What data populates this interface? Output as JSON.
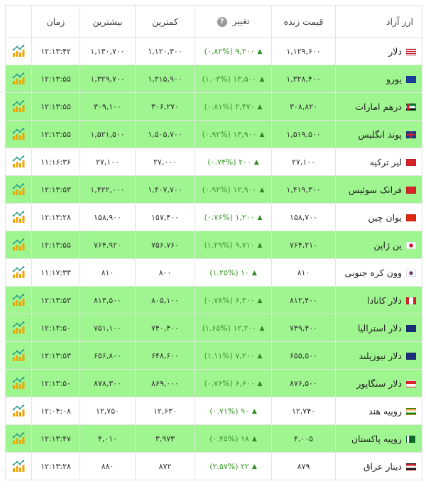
{
  "headers": {
    "name": "ارز آزاد",
    "live": "قیمت زنده",
    "change": "تغییر",
    "change_help": "?",
    "low": "کمترین",
    "high": "بیشترین",
    "time": "زمان"
  },
  "rows": [
    {
      "name": "دلار",
      "flag": "us-flag-icon",
      "live": "۱,۱۲۹,۶۰۰",
      "change": "۹,۲۰۰ (۰.۸۲%)",
      "low": "۱,۱۲۰,۳۰۰",
      "high": "۱,۱۳۰,۷۰۰",
      "time": "۱۲:۱۳:۴۲",
      "bg": "white"
    },
    {
      "name": "یورو",
      "flag": "eu-flag-icon",
      "live": "۱,۳۲۸,۴۰۰",
      "change": "۱۳,۵۰۰ (۱.۰۳%)",
      "low": "۱,۳۱۵,۹۰۰",
      "high": "۱,۳۲۹,۷۰۰",
      "time": "۱۲:۱۳:۵۵",
      "bg": "green"
    },
    {
      "name": "درهم امارات",
      "flag": "ae-flag-icon",
      "live": "۳۰۸,۸۲۰",
      "change": "۲,۴۷۰ (۰.۸۱%)",
      "low": "۳۰۶,۲۷۰",
      "high": "۳۰۹,۱۰۰",
      "time": "۱۲:۱۳:۵۵",
      "bg": "green"
    },
    {
      "name": "پوند انگلیس",
      "flag": "gb-flag-icon",
      "live": "۱,۵۱۹,۵۰۰",
      "change": "۱۳,۹۰۰ (۰.۹۲%)",
      "low": "۱,۵۰۵,۷۰۰",
      "high": "۱,۵۲۱,۵۰۰",
      "time": "۱۲:۱۳:۵۵",
      "bg": "green"
    },
    {
      "name": "لیر ترکیه",
      "flag": "tr-flag-icon",
      "live": "۲۷,۱۰۰",
      "change": "۲۰۰ (۰.۷۴%)",
      "low": "۲۷,۰۰۰",
      "high": "۲۷,۱۰۰",
      "time": "۱۱:۱۶:۳۶",
      "bg": "white"
    },
    {
      "name": "فرانک سوئیس",
      "flag": "ch-flag-icon",
      "live": "۱,۴۱۹,۳۰۰",
      "change": "۱۲,۹۰۰ (۰.۹۲%)",
      "low": "۱,۴۰۷,۷۰۰",
      "high": "۱,۴۲۲,۰۰۰",
      "time": "۱۲:۱۳:۵۳",
      "bg": "green"
    },
    {
      "name": "یوان چین",
      "flag": "cn-flag-icon",
      "live": "۱۵۸,۷۰۰",
      "change": "۱,۲۰۰ (۰.۷۶%)",
      "low": "۱۵۷,۴۰۰",
      "high": "۱۵۸,۹۰۰",
      "time": "۱۲:۱۳:۲۸",
      "bg": "white"
    },
    {
      "name": "ین ژاپن",
      "flag": "jp-flag-icon",
      "live": "۷۶۴,۲۱۰",
      "change": "۹,۷۱۰ (۱.۲۹%)",
      "low": "۷۵۶,۷۶۰",
      "high": "۷۶۴,۹۲۰",
      "time": "۱۲:۱۳:۵۵",
      "bg": "green"
    },
    {
      "name": "وون کره جنوبی",
      "flag": "kr-flag-icon",
      "live": "۸۱۰",
      "change": "۱۰ (۱.۲۵%)",
      "low": "۸۰۰",
      "high": "۸۱۰",
      "time": "۱۱:۱۷:۳۳",
      "bg": "white"
    },
    {
      "name": "دلار کانادا",
      "flag": "ca-flag-icon",
      "live": "۸۱۲,۴۰۰",
      "change": "۶,۳۰۰ (۰.۷۸%)",
      "low": "۸۰۵,۱۰۰",
      "high": "۸۱۳,۵۰۰",
      "time": "۱۲:۱۳:۵۳",
      "bg": "green"
    },
    {
      "name": "دلار استرالیا",
      "flag": "au-flag-icon",
      "live": "۷۴۹,۴۰۰",
      "change": "۱۲,۲۰۰ (۱.۶۵%)",
      "low": "۷۴۰,۴۰۰",
      "high": "۷۵۱,۱۰۰",
      "time": "۱۲:۱۳:۵۰",
      "bg": "green"
    },
    {
      "name": "دلار نیوزیلند",
      "flag": "nz-flag-icon",
      "live": "۶۵۵,۵۰۰",
      "change": "۷,۲۰۰ (۱.۱۱%)",
      "low": "۶۴۸,۶۰۰",
      "high": "۶۵۶,۸۰۰",
      "time": "۱۲:۱۳:۵۳",
      "bg": "green"
    },
    {
      "name": "دلار سنگاپور",
      "flag": "sg-flag-icon",
      "live": "۸۷۶,۵۰۰",
      "change": "۶,۶۰۰ (۰.۷۶%)",
      "low": "۸۶۹,۰۰۰",
      "high": "۸۷۸,۳۰۰",
      "time": "۱۲:۱۳:۵۰",
      "bg": "green"
    },
    {
      "name": "روپیه هند",
      "flag": "in-flag-icon",
      "live": "۱۲,۷۴۰",
      "change": "۹۰ (۰.۷۱%)",
      "low": "۱۲,۶۳۰",
      "high": "۱۲,۷۵۰",
      "time": "۱۲:۰۴:۰۸",
      "bg": "white"
    },
    {
      "name": "روپیه پاکستان",
      "flag": "pk-flag-icon",
      "live": "۴,۰۰۵",
      "change": "۱۸ (۰.۴۵%)",
      "low": "۳,۹۷۳",
      "high": "۴,۰۱۰",
      "time": "۱۲:۱۳:۴۷",
      "bg": "green"
    },
    {
      "name": "دینار عراق",
      "flag": "iq-flag-icon",
      "live": "۸۷۹",
      "change": "۲۲ (۲.۵۷%)",
      "low": "۸۷۲",
      "high": "۸۸۰",
      "time": "۱۲:۱۳:۲۸",
      "bg": "white"
    }
  ],
  "colors": {
    "row_green": "#9ff58f",
    "change_text": "#3a9a2a"
  },
  "icons": {
    "change_arrow": "chevron-up-icon",
    "row_action": "chart-icon"
  }
}
